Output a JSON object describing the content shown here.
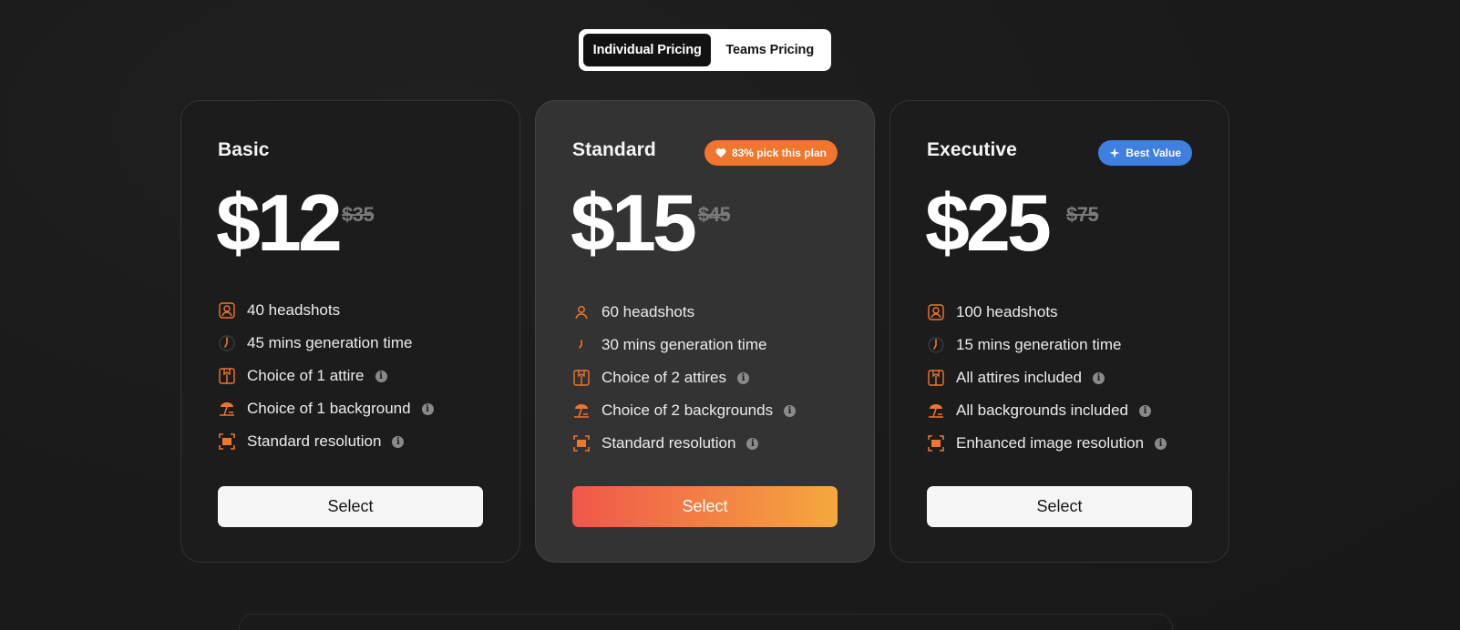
{
  "toggle": {
    "active": "Individual Pricing",
    "inactive": "Teams Pricing"
  },
  "colors": {
    "accent_orange": "#f0752d",
    "badge_blue": "#3f7fe0",
    "gradient_start": "#f0574b",
    "gradient_end": "#f4a83e"
  },
  "plans": [
    {
      "name": "Basic",
      "price": "$12",
      "old_price": "$35",
      "badge": null,
      "features": [
        "40 headshots",
        "45 mins generation time",
        "Choice of 1 attire",
        "Choice of 1 background",
        "Standard resolution"
      ],
      "button": "Select"
    },
    {
      "name": "Standard",
      "price": "$15",
      "old_price": "$45",
      "badge": "83% pick this plan",
      "features": [
        "60 headshots",
        "30 mins generation time",
        "Choice of 2 attires",
        "Choice of 2 backgrounds",
        "Standard resolution"
      ],
      "button": "Select"
    },
    {
      "name": "Executive",
      "price": "$25",
      "old_price": "$75",
      "badge": "Best Value",
      "features": [
        "100 headshots",
        "15 mins generation time",
        "All attires included",
        "All backgrounds included",
        "Enhanced image resolution"
      ],
      "button": "Select"
    }
  ],
  "feature_icons": [
    "user-icon",
    "clock-icon",
    "attire-icon",
    "beach-umbrella-icon",
    "resolution-icon"
  ]
}
